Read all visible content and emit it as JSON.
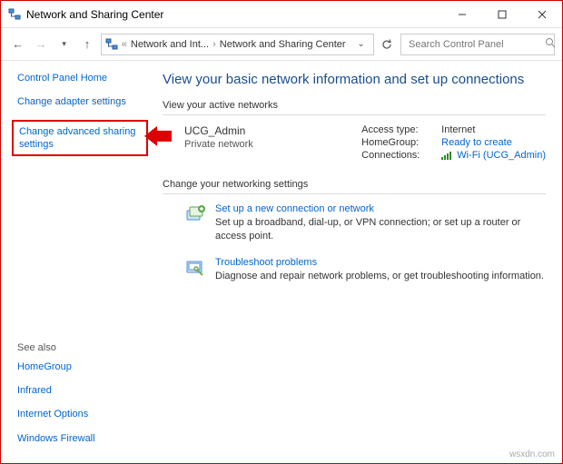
{
  "window": {
    "title": "Network and Sharing Center"
  },
  "breadcrumb": {
    "item1": "Network and Int...",
    "item2": "Network and Sharing Center"
  },
  "search": {
    "placeholder": "Search Control Panel"
  },
  "sidebar": {
    "home": "Control Panel Home",
    "adapter": "Change adapter settings",
    "advanced": "Change advanced sharing settings",
    "seealso_h": "See also",
    "seealso": {
      "homegroup": "HomeGroup",
      "infrared": "Infrared",
      "inetopts": "Internet Options",
      "firewall": "Windows Firewall"
    }
  },
  "main": {
    "heading": "View your basic network information and set up connections",
    "active_h": "View your active networks",
    "network": {
      "name": "UCG_Admin",
      "type": "Private network",
      "access_k": "Access type:",
      "access_v": "Internet",
      "homegroup_k": "HomeGroup:",
      "homegroup_v": "Ready to create",
      "conn_k": "Connections:",
      "conn_v": "Wi-Fi (UCG_Admin)"
    },
    "change_h": "Change your networking settings",
    "action1": {
      "title": "Set up a new connection or network",
      "desc": "Set up a broadband, dial-up, or VPN connection; or set up a router or access point."
    },
    "action2": {
      "title": "Troubleshoot problems",
      "desc": "Diagnose and repair network problems, or get troubleshooting information."
    }
  },
  "watermark": "wsxdn.com"
}
